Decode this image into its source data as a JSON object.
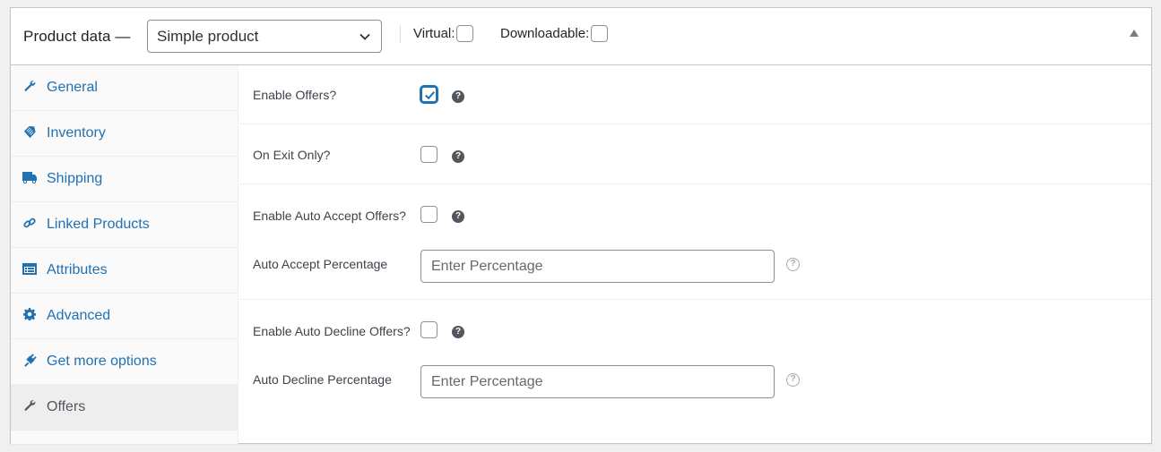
{
  "header": {
    "title": "Product data —",
    "product_type": {
      "selected": "Simple product"
    },
    "options": [
      {
        "label": "Virtual:",
        "checked": false
      },
      {
        "label": "Downloadable:",
        "checked": false
      }
    ],
    "collapse_icon": "triangle-up-icon"
  },
  "tabs": [
    {
      "label": "General",
      "icon": "wrench-icon",
      "active": false
    },
    {
      "label": "Inventory",
      "icon": "tag-icon",
      "active": false
    },
    {
      "label": "Shipping",
      "icon": "truck-icon",
      "active": false
    },
    {
      "label": "Linked Products",
      "icon": "link-icon",
      "active": false
    },
    {
      "label": "Attributes",
      "icon": "list-card-icon",
      "active": false
    },
    {
      "label": "Advanced",
      "icon": "gear-icon",
      "active": false
    },
    {
      "label": "Get more options",
      "icon": "plug-icon",
      "active": false
    },
    {
      "label": "Offers",
      "icon": "wrench-icon",
      "active": true
    }
  ],
  "offers": {
    "enable_offers": {
      "label": "Enable Offers?",
      "checked": true
    },
    "on_exit_only": {
      "label": "On Exit Only?",
      "checked": false
    },
    "auto_accept": {
      "enable_label": "Enable Auto Accept Offers?",
      "checked": false,
      "percentage_label": "Auto Accept Percentage",
      "placeholder": "Enter Percentage",
      "value": ""
    },
    "auto_decline": {
      "enable_label": "Enable Auto Decline Offers?",
      "checked": false,
      "percentage_label": "Auto Decline Percentage",
      "placeholder": "Enter Percentage",
      "value": ""
    },
    "help_glyph": "?"
  },
  "colors": {
    "accent": "#2271b1",
    "active_tab_text": "#50575e"
  }
}
